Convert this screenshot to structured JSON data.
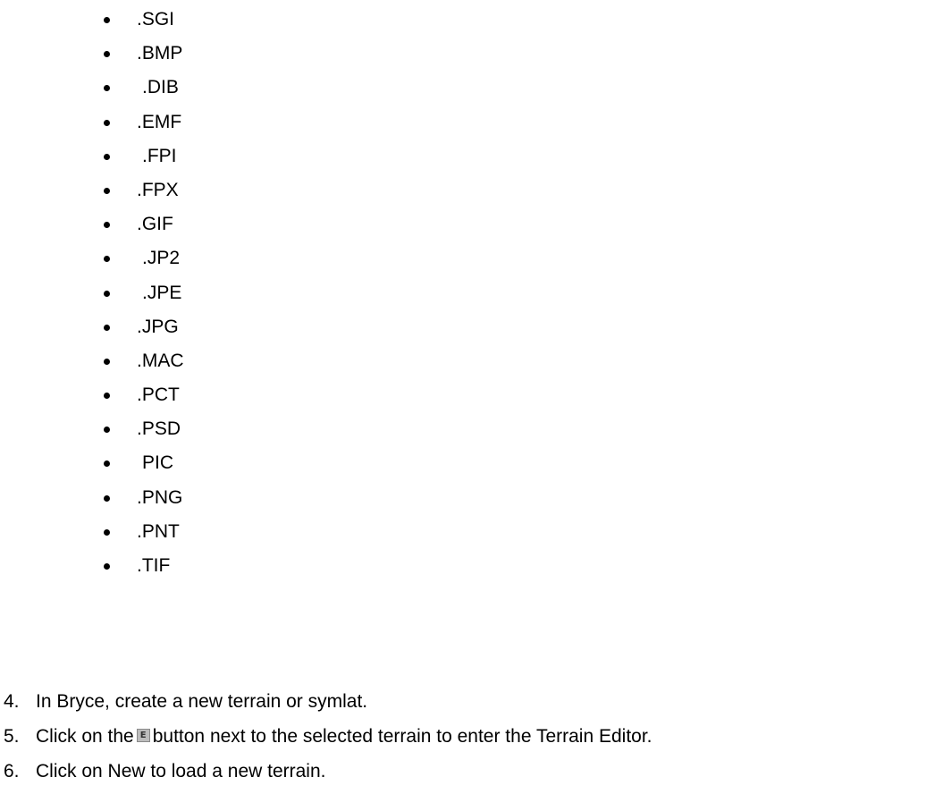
{
  "formats": [
    ".SGI",
    ".BMP",
    ".DIB",
    ".EMF",
    ".FPI",
    ".FPX",
    ".GIF",
    ".JP2",
    ".JPE",
    ".JPG",
    ".MAC",
    ".PCT",
    ".PSD",
    "PIC",
    ".PNG",
    ".PNT",
    ".TIF"
  ],
  "steps": {
    "s4": {
      "num": "4.",
      "text": "In Bryce, create a new terrain or symlat."
    },
    "s5": {
      "num": "5.",
      "before": "Click on the",
      "icon": "E",
      "after": "button next to the selected terrain to enter the Terrain Editor."
    },
    "s6": {
      "num": "6.",
      "text": "Click on New to load a new terrain."
    }
  }
}
